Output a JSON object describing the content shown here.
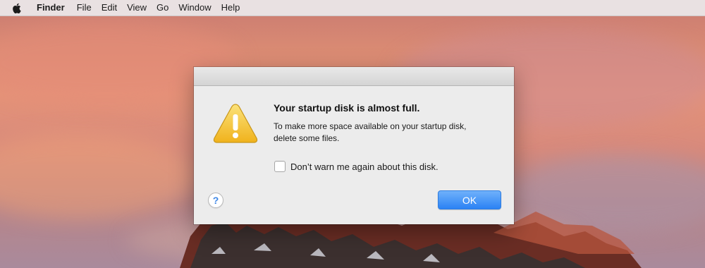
{
  "menubar": {
    "apple_icon": "apple-logo-icon",
    "items": [
      "Finder",
      "File",
      "Edit",
      "View",
      "Go",
      "Window",
      "Help"
    ]
  },
  "dialog": {
    "icon": "warning-triangle-icon",
    "title": "Your startup disk is almost full.",
    "message_lines": [
      "To make more space available on your startup disk,",
      "delete some files."
    ],
    "checkbox": {
      "label": "Don’t warn me again about this disk.",
      "checked": false
    },
    "help_label": "?",
    "ok_label": "OK"
  },
  "colors": {
    "accent_button": "#3b8ef7",
    "warning_icon": "#f5c22e"
  }
}
